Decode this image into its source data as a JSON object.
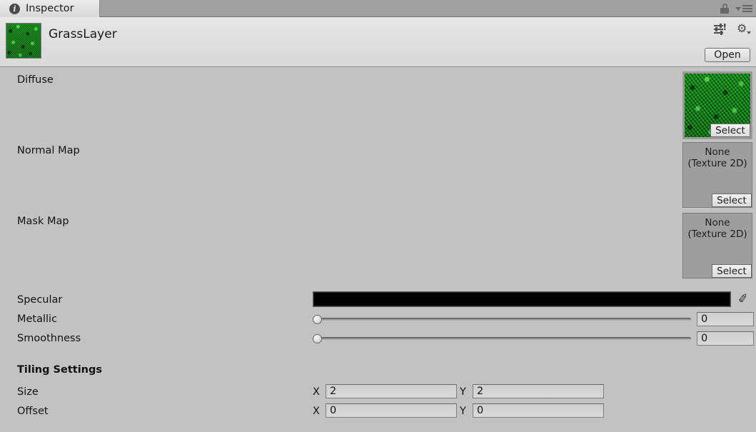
{
  "window": {
    "tab_label": "Inspector",
    "tab_icon": "info-icon",
    "info_glyph": "i",
    "lock_icon": "lock-icon",
    "menu_icon": "hamburger-menu-icon"
  },
  "header": {
    "object_name": "GrassLayer",
    "thumbnail_icon": "grass-texture-thumbnail",
    "preset_icon": "preset-selector-icon",
    "preset_badge": "!",
    "gear_icon": "gear-icon",
    "gear_glyph": "⚙",
    "open_label": "Open"
  },
  "properties": {
    "diffuse": {
      "label": "Diffuse",
      "value": "grass-texture",
      "select_label": "Select",
      "filled": true
    },
    "normal_map": {
      "label": "Normal Map",
      "value_line1": "None",
      "value_line2": "(Texture 2D)",
      "select_label": "Select",
      "filled": false
    },
    "mask_map": {
      "label": "Mask Map",
      "value_line1": "None",
      "value_line2": "(Texture 2D)",
      "select_label": "Select",
      "filled": false
    },
    "specular": {
      "label": "Specular",
      "color": "#000000",
      "eyedropper_icon": "eyedropper-icon",
      "eyedropper_glyph": "✐"
    },
    "metallic": {
      "label": "Metallic",
      "value": "0",
      "slider_percent": 0
    },
    "smoothness": {
      "label": "Smoothness",
      "value": "0",
      "slider_percent": 0
    }
  },
  "tiling": {
    "section_title": "Tiling Settings",
    "size": {
      "label": "Size",
      "x_axis": "X",
      "x_value": "2",
      "y_axis": "Y",
      "y_value": "2"
    },
    "offset": {
      "label": "Offset",
      "x_axis": "X",
      "x_value": "0",
      "y_axis": "Y",
      "y_value": "0"
    }
  },
  "colors": {
    "panel_bg": "#c2c2c2",
    "tabbar_bg": "#a0a0a0",
    "tab_bg": "#e6e6e6",
    "header_bg": "#e0e0e0",
    "grass_green": "#0c7a16",
    "specular_black": "#000000"
  }
}
